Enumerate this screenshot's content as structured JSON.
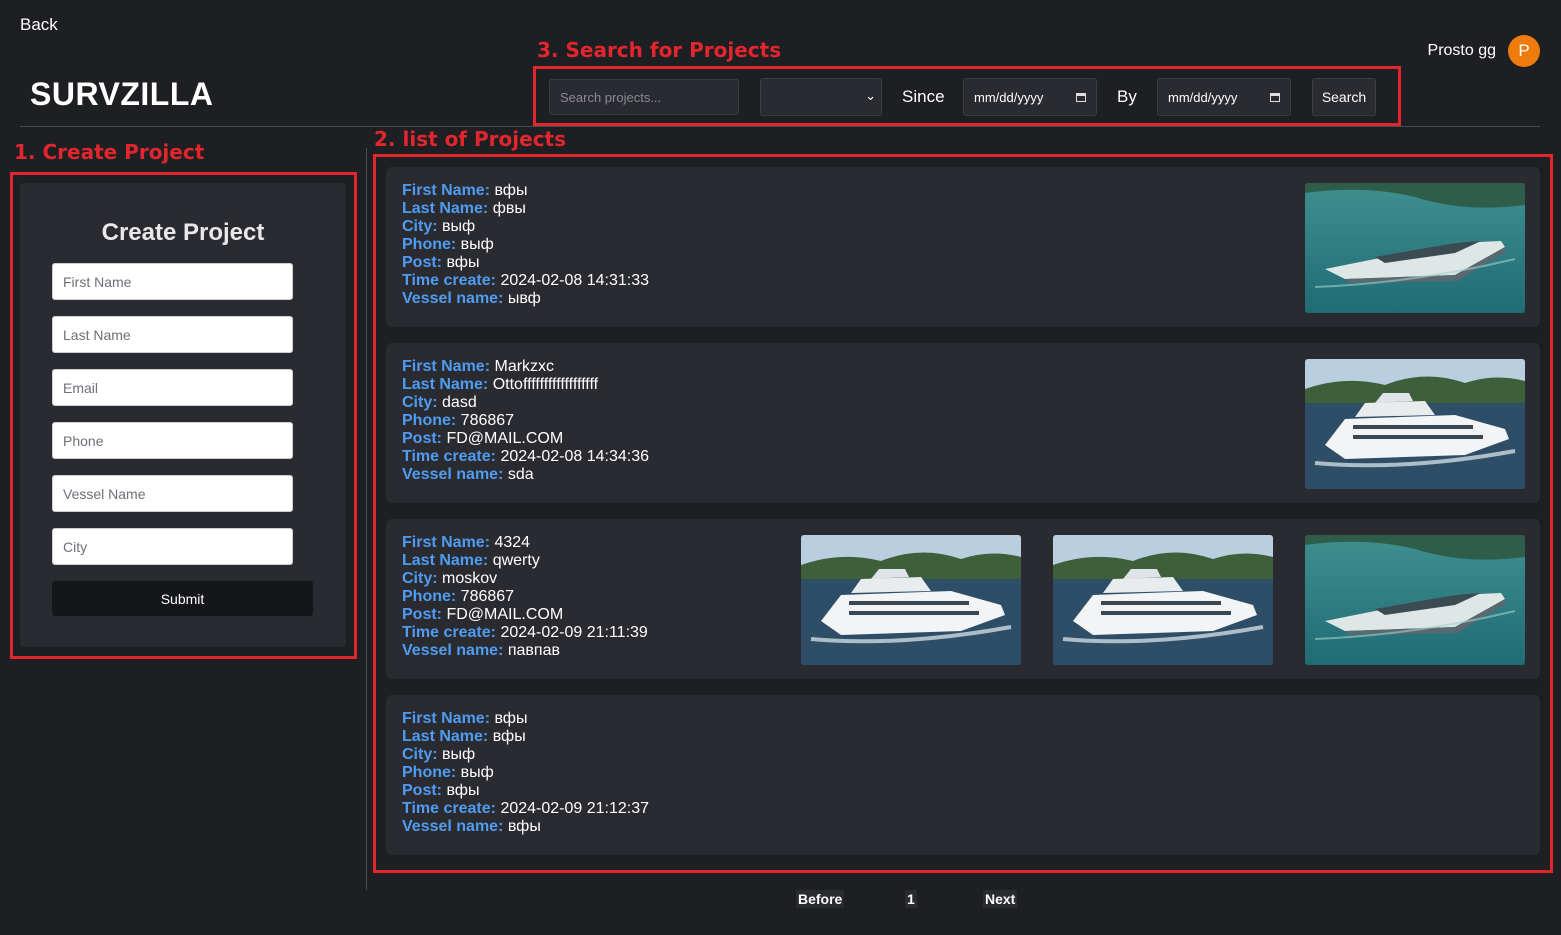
{
  "nav": {
    "back_label": "Back"
  },
  "brand": {
    "logo": "SURVZILLA"
  },
  "user": {
    "name": "Prosto gg",
    "avatar_initial": "P"
  },
  "annotations": {
    "search": "3. Search for Projects",
    "list": "2. list of Projects",
    "create": "1. Create Project"
  },
  "search": {
    "placeholder": "Search projects...",
    "since_label": "Since",
    "by_label": "By",
    "since_date": "mm/dd/yyyy",
    "by_date": "mm/dd/yyyy",
    "button_label": "Search"
  },
  "create_form": {
    "title": "Create Project",
    "first_name_placeholder": "First Name",
    "last_name_placeholder": "Last Name",
    "email_placeholder": "Email",
    "phone_placeholder": "Phone",
    "vessel_placeholder": "Vessel Name",
    "city_placeholder": "City",
    "submit_label": "Submit"
  },
  "labels": {
    "first_name": "First Name:",
    "last_name": "Last Name:",
    "city": "City:",
    "phone": "Phone:",
    "post": "Post:",
    "time_create": "Time create:",
    "vessel_name": "Vessel name:"
  },
  "projects": [
    {
      "first_name": "вфы",
      "last_name": "фвы",
      "city": "выф",
      "phone": "выф",
      "post": "вфы",
      "time_create": "2024-02-08 14:31:33",
      "vessel_name": "ывф",
      "images": [
        "teal-yacht"
      ]
    },
    {
      "first_name": "Markzxc",
      "last_name": "Ottoffffffffffffffffff",
      "city": "dasd",
      "phone": "786867",
      "post": "FD@MAIL.COM",
      "time_create": "2024-02-08 14:34:36",
      "vessel_name": "sda",
      "images": [
        "white-superyacht"
      ]
    },
    {
      "first_name": "4324",
      "last_name": "qwerty",
      "city": "moskov",
      "phone": "786867",
      "post": "FD@MAIL.COM",
      "time_create": "2024-02-09 21:11:39",
      "vessel_name": "павпав",
      "images": [
        "white-superyacht",
        "white-superyacht",
        "teal-yacht"
      ]
    },
    {
      "first_name": "вфы",
      "last_name": "вфы",
      "city": "выф",
      "phone": "выф",
      "post": "вфы",
      "time_create": "2024-02-09 21:12:37",
      "vessel_name": "вфы",
      "images": []
    }
  ],
  "pagination": {
    "prev_label": "Before",
    "page": "1",
    "next_label": "Next"
  },
  "colors": {
    "annotation": "#e3262d",
    "field_label": "#4f9cf2",
    "avatar": "#f07b0d",
    "background": "#1e1f22",
    "card": "#2a2b30"
  }
}
